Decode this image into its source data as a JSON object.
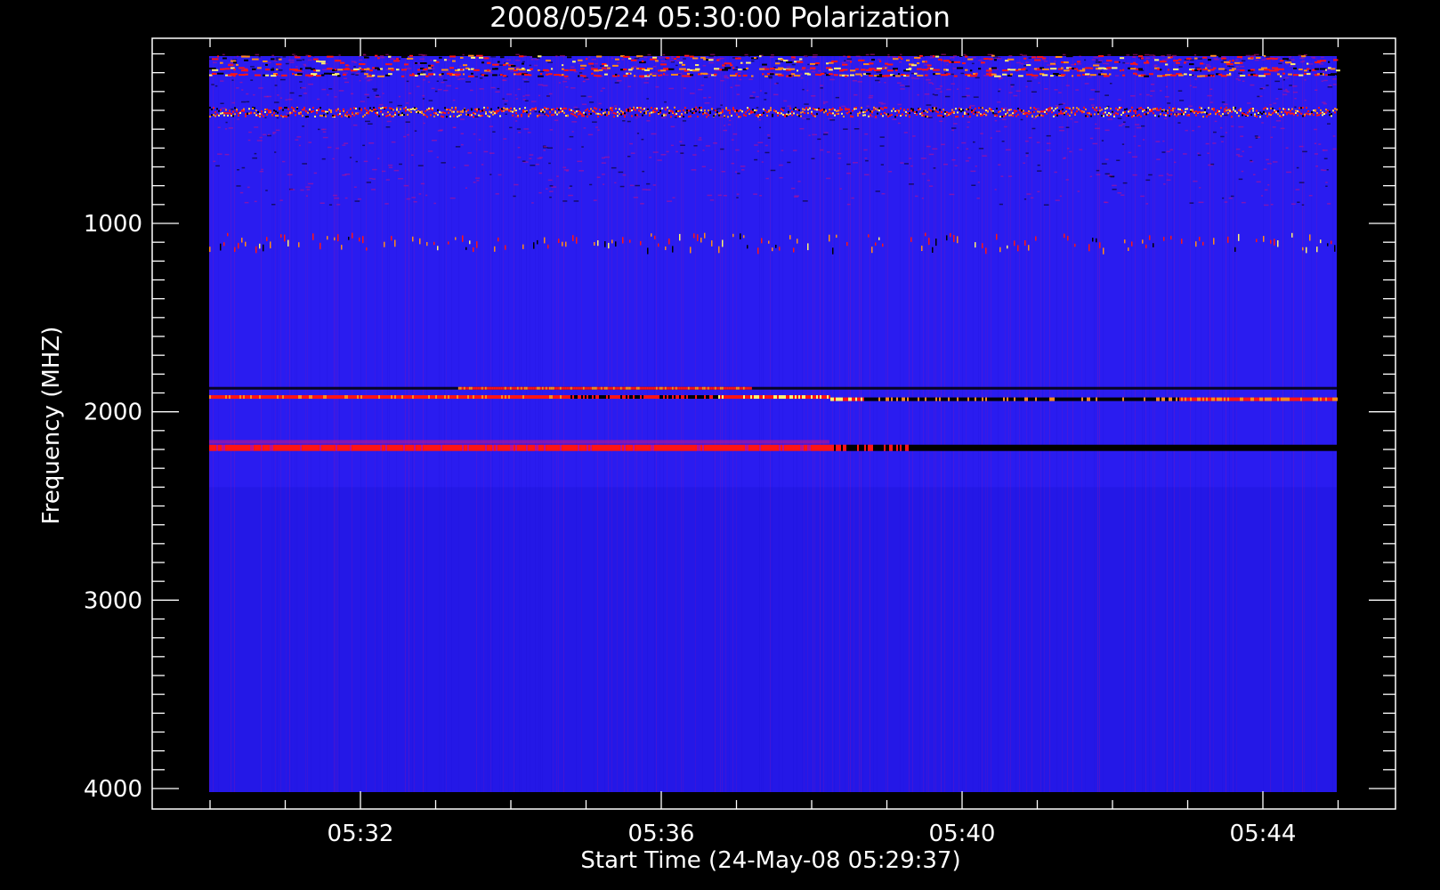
{
  "chart_data": {
    "type": "heatmap",
    "title": "2008/05/24 05:30:00 Polarization",
    "xlabel": "Start Time (24-May-08 05:29:37)",
    "ylabel": "Frequency (MHZ)",
    "x_ticks": [
      "05:32",
      "05:36",
      "05:40",
      "05:44"
    ],
    "y_ticks": [
      1000,
      2000,
      3000,
      4000
    ],
    "y_reversed": true,
    "colors": {
      "background": "#000000",
      "base": "#2a1cf0",
      "deep": "#1a10d8",
      "noise_red": "#c0108a",
      "hot_red": "#ff1414",
      "orange": "#ff8a1a",
      "yellow": "#fff070",
      "dark": "#000000"
    },
    "bands": [
      {
        "freq_low": 110,
        "freq_high": 160,
        "intensity": "mixed",
        "note": "strong interference"
      },
      {
        "freq_low": 180,
        "freq_high": 230,
        "intensity": "mixed"
      },
      {
        "freq_low": 380,
        "freq_high": 440,
        "intensity": "bright"
      },
      {
        "freq_low": 1050,
        "freq_high": 1130,
        "intensity": "sparse"
      },
      {
        "freq_low": 1860,
        "freq_high": 1880,
        "intensity": "dark-to-red"
      },
      {
        "freq_low": 1900,
        "freq_high": 1940,
        "intensity": "red-to-dark"
      },
      {
        "freq_low": 2160,
        "freq_high": 2220,
        "intensity": "red-to-dark"
      }
    ]
  }
}
